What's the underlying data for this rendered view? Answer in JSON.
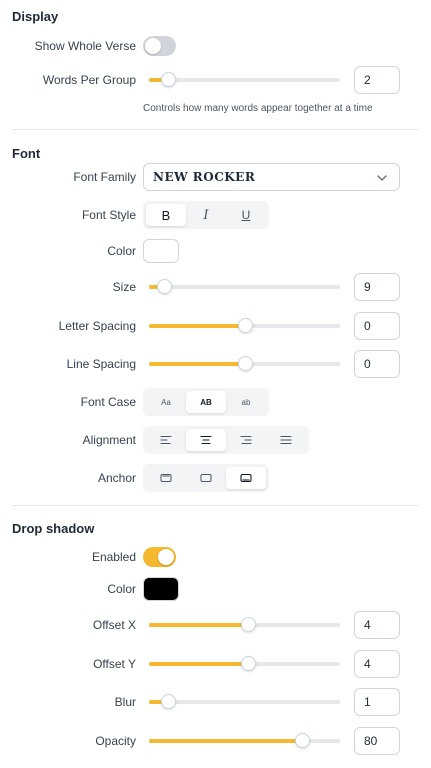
{
  "display": {
    "title": "Display",
    "show_whole_verse": {
      "label": "Show Whole Verse",
      "on": false
    },
    "words_per_group": {
      "label": "Words Per Group",
      "value": "2",
      "fraction": 0.1,
      "help": "Controls how many words appear together at a time"
    }
  },
  "font": {
    "title": "Font",
    "family": {
      "label": "Font Family",
      "value": "NEW ROCKER"
    },
    "style": {
      "label": "Font Style",
      "options": [
        "B",
        "I",
        "U"
      ],
      "active": 0
    },
    "color": {
      "label": "Color",
      "value": "#ffffff"
    },
    "size": {
      "label": "Size",
      "value": "9",
      "fraction": 0.08
    },
    "letter_spacing": {
      "label": "Letter Spacing",
      "value": "0",
      "fraction": 0.5
    },
    "line_spacing": {
      "label": "Line Spacing",
      "value": "0",
      "fraction": 0.5
    },
    "case": {
      "label": "Font Case",
      "options": [
        "Aa",
        "AB",
        "ab"
      ],
      "active": 1
    },
    "alignment": {
      "label": "Alignment",
      "options": [
        "align-left-icon",
        "align-center-icon",
        "align-right-icon",
        "align-justify-icon"
      ],
      "active": 1
    },
    "anchor": {
      "label": "Anchor",
      "options": [
        "anchor-top-icon",
        "anchor-middle-icon",
        "anchor-bottom-icon"
      ],
      "active": 2
    }
  },
  "drop_shadow": {
    "title": "Drop shadow",
    "enabled": {
      "label": "Enabled",
      "on": true
    },
    "color": {
      "label": "Color",
      "value": "#000000"
    },
    "offset_x": {
      "label": "Offset X",
      "value": "4",
      "fraction": 0.52
    },
    "offset_y": {
      "label": "Offset Y",
      "value": "4",
      "fraction": 0.52
    },
    "blur": {
      "label": "Blur",
      "value": "1",
      "fraction": 0.1
    },
    "opacity": {
      "label": "Opacity",
      "value": "80",
      "fraction": 0.8
    }
  },
  "colors": {
    "accent": "#f5b82e",
    "track": "#e5e7eb"
  }
}
